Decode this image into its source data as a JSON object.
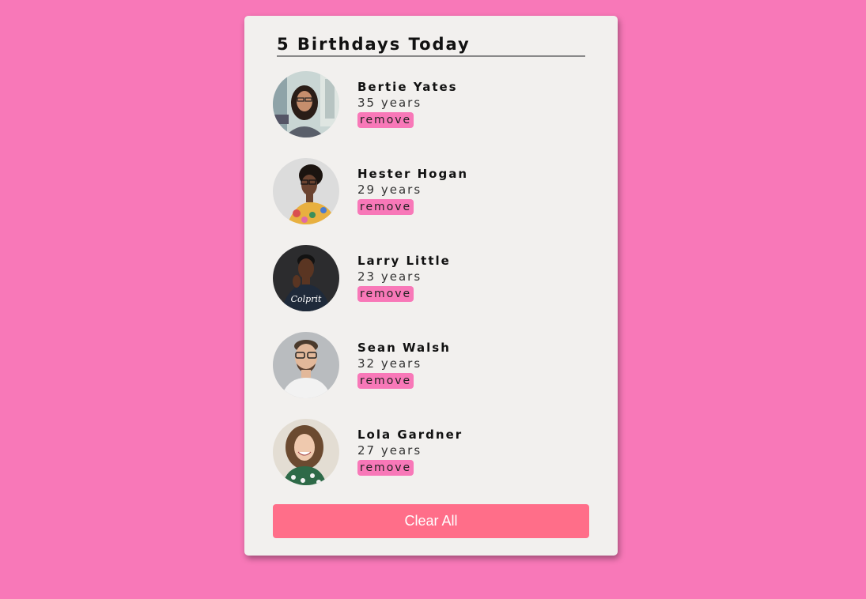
{
  "header": {
    "title": "5 Birthdays Today"
  },
  "people": [
    {
      "name": "Bertie Yates",
      "age": "35 years",
      "remove_label": "remove"
    },
    {
      "name": "Hester Hogan",
      "age": "29 years",
      "remove_label": "remove"
    },
    {
      "name": "Larry Little",
      "age": "23 years",
      "remove_label": "remove"
    },
    {
      "name": "Sean Walsh",
      "age": "32 years",
      "remove_label": "remove"
    },
    {
      "name": "Lola Gardner",
      "age": "27 years",
      "remove_label": "remove"
    }
  ],
  "footer": {
    "clear_label": "Clear All"
  },
  "colors": {
    "background": "#f878b8",
    "card": "#f2f0ee",
    "clear_button": "#ff6e89",
    "remove_button": "#f878b8"
  },
  "shirt_text": "Colprit"
}
